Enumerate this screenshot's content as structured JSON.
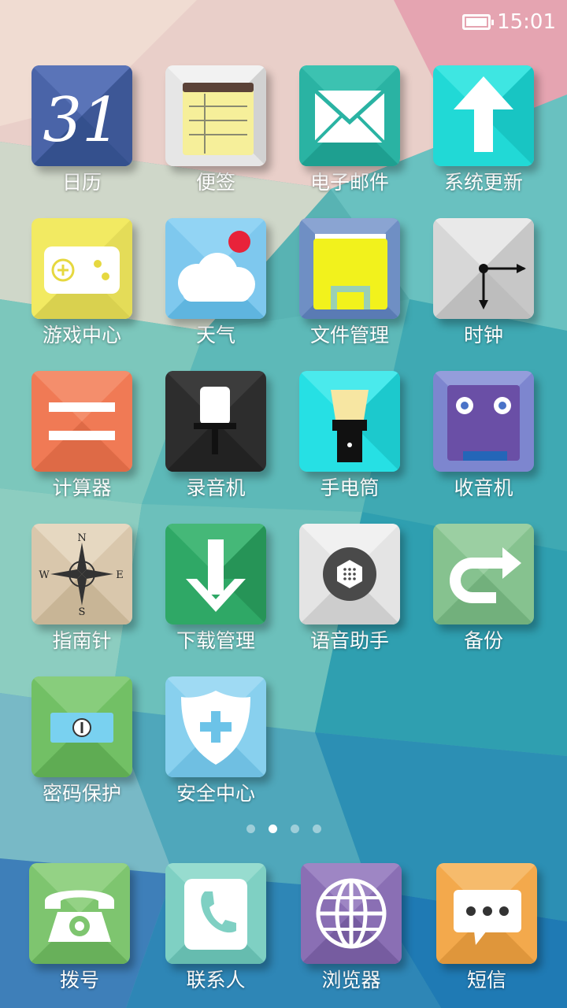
{
  "status_bar": {
    "time": "15:01",
    "battery_icon": "battery-full-icon"
  },
  "page_indicator": {
    "count": 4,
    "active_index": 1
  },
  "apps": [
    {
      "label": "日历",
      "icon": "calendar-icon",
      "icon_text": "31",
      "color": "#4a64a8"
    },
    {
      "label": "便签",
      "icon": "notepad-icon",
      "color": "#e8e8e8"
    },
    {
      "label": "电子邮件",
      "icon": "mail-icon",
      "color": "#2ab3a3"
    },
    {
      "label": "系统更新",
      "icon": "arrow-up-icon",
      "color": "#21d9d6"
    },
    {
      "label": "游戏中心",
      "icon": "gamepad-icon",
      "color": "#f2ea62"
    },
    {
      "label": "天气",
      "icon": "cloud-icon",
      "color": "#7ec8ee"
    },
    {
      "label": "文件管理",
      "icon": "floppy-disk-icon",
      "color": "#6f8fc4"
    },
    {
      "label": "时钟",
      "icon": "clock-icon",
      "color": "#d7d7d7"
    },
    {
      "label": "计算器",
      "icon": "equals-icon",
      "color": "#f07a55"
    },
    {
      "label": "录音机",
      "icon": "microphone-icon",
      "color": "#2d2d2d"
    },
    {
      "label": "手电筒",
      "icon": "flashlight-icon",
      "color": "#26e0e4"
    },
    {
      "label": "收音机",
      "icon": "radio-icon",
      "color": "#7d86cf"
    },
    {
      "label": "指南针",
      "icon": "compass-icon",
      "color": "#d9c7ac",
      "compass": [
        "N",
        "E",
        "S",
        "W"
      ]
    },
    {
      "label": "下载管理",
      "icon": "download-arrow-icon",
      "color": "#2fa866"
    },
    {
      "label": "语音助手",
      "icon": "voice-assistant-icon",
      "color": "#e4e4e4"
    },
    {
      "label": "备份",
      "icon": "backup-arrow-icon",
      "color": "#86c28f"
    },
    {
      "label": "密码保护",
      "icon": "password-lock-icon",
      "color": "#72c065"
    },
    {
      "label": "安全中心",
      "icon": "shield-icon",
      "color": "#88d0ee"
    }
  ],
  "dock": [
    {
      "label": "拨号",
      "icon": "phone-icon",
      "color": "#7ec56f"
    },
    {
      "label": "联系人",
      "icon": "contacts-phone-icon",
      "color": "#7fd0c3"
    },
    {
      "label": "浏览器",
      "icon": "globe-icon",
      "color": "#8a6fb4"
    },
    {
      "label": "短信",
      "icon": "message-bubble-icon",
      "color": "#f3a94c"
    }
  ]
}
